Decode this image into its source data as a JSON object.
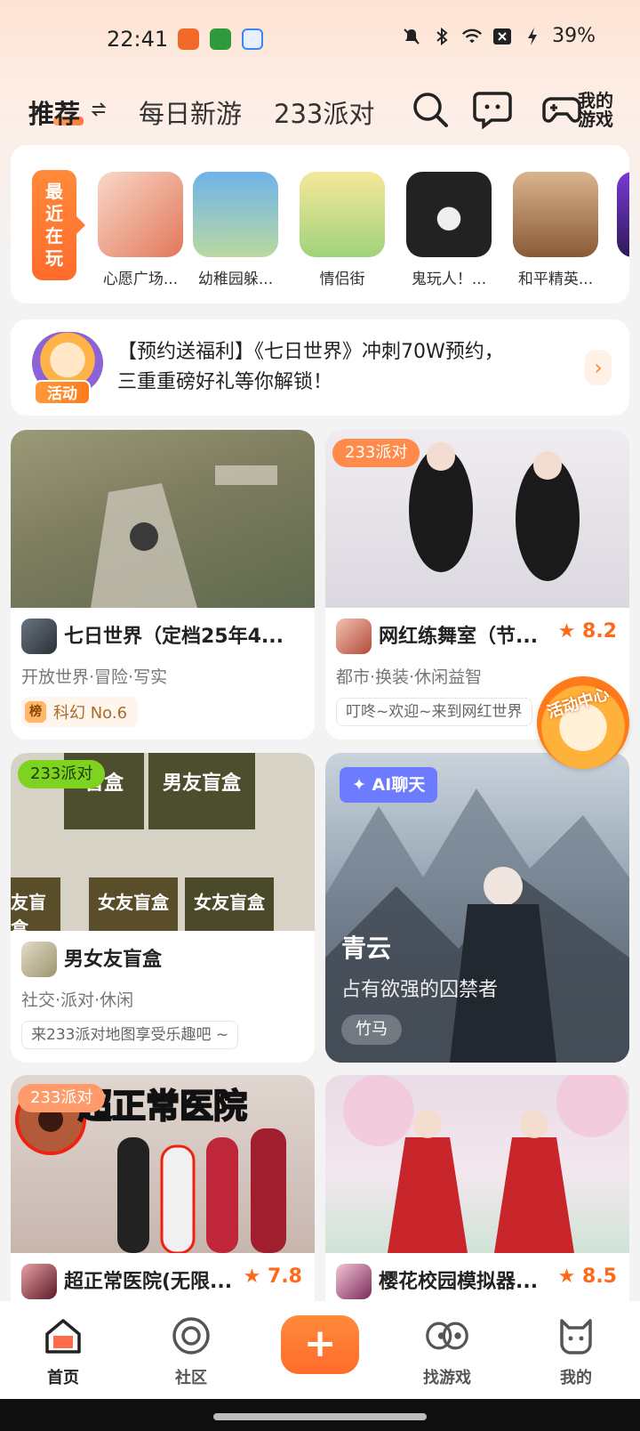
{
  "status_bar": {
    "time": "22:41",
    "battery": "39%",
    "app_icon_colors": [
      "#f26a2a",
      "#2f9a3b",
      "#3a86ff"
    ]
  },
  "top_nav": {
    "tabs": [
      {
        "label": "推荐",
        "active": true
      },
      {
        "label": "每日新游",
        "active": false
      },
      {
        "label": "233派对",
        "active": false
      }
    ],
    "my_games_label_line1": "我的",
    "my_games_label_line2": "游戏"
  },
  "recent": {
    "badge_chars": [
      "最",
      "近",
      "在",
      "玩"
    ],
    "items": [
      {
        "name": "心愿广场...",
        "color": "#f4c7b6"
      },
      {
        "name": "幼稚园躲...",
        "color": "#8fc1e8"
      },
      {
        "name": "情侣街",
        "color": "#f3e08a"
      },
      {
        "name": "鬼玩人！...",
        "color": "#2b2020"
      },
      {
        "name": "和平精英...",
        "color": "#c8a27a"
      },
      {
        "name": "",
        "color": "#7a3ad6"
      }
    ]
  },
  "promo": {
    "tag": "活动",
    "line1": "【预约送福利】《七日世界》冲刺70W预约，",
    "line2": "三重重磅好礼等你解锁！"
  },
  "cards": [
    {
      "title": "七日世界（定档25年4...",
      "genres": "开放世界·冒险·写实",
      "rank_badge": "榜",
      "rank_text": "科幻 No.6",
      "image_color": "#8a8a6e",
      "icon_color": "#4a5560"
    },
    {
      "tag": "233派对",
      "title": "网红练舞室（节...",
      "rating": "8.2",
      "genres": "都市·换装·休闲益智",
      "desc": "叮咚~欢迎~来到网红世界",
      "image_color": "#e9e6ec",
      "icon_color": "#c9563c"
    },
    {
      "tag": "233派对",
      "title": "男女友盲盒",
      "genres": "社交·派对·休闲",
      "desc": "来233派对地图享受乐趣吧 ~",
      "image_color": "#cfcbbf",
      "icon_color": "#c9c2a8",
      "image_words": [
        "男友盲盒",
        "女友盲盒",
        "女友盲盒",
        "友盲盒",
        "盲盒"
      ]
    },
    {
      "tag": "233派对",
      "title": "超正常医院(无限...",
      "rating": "7.8",
      "image_color": "#d8c8c0",
      "icon_color": "#7a2a3a",
      "image_caption": "超正常医院"
    },
    {
      "title": "樱花校园模拟器...",
      "rating": "8.5",
      "image_color": "#e6d8e6",
      "icon_color": "#b04868"
    }
  ],
  "ai_card": {
    "pill": "AI聊天",
    "name": "青云",
    "subtitle": "占有欲强的囚禁者",
    "tag": "竹马"
  },
  "activity_fab": {
    "label": "活动中心"
  },
  "bottom_nav": {
    "items": [
      {
        "label": "首页",
        "active": true
      },
      {
        "label": "社区",
        "active": false
      },
      {
        "label": "找游戏",
        "active": false
      },
      {
        "label": "我的",
        "active": false
      }
    ],
    "plus": "+"
  },
  "accent_color": "#ff6b2c"
}
